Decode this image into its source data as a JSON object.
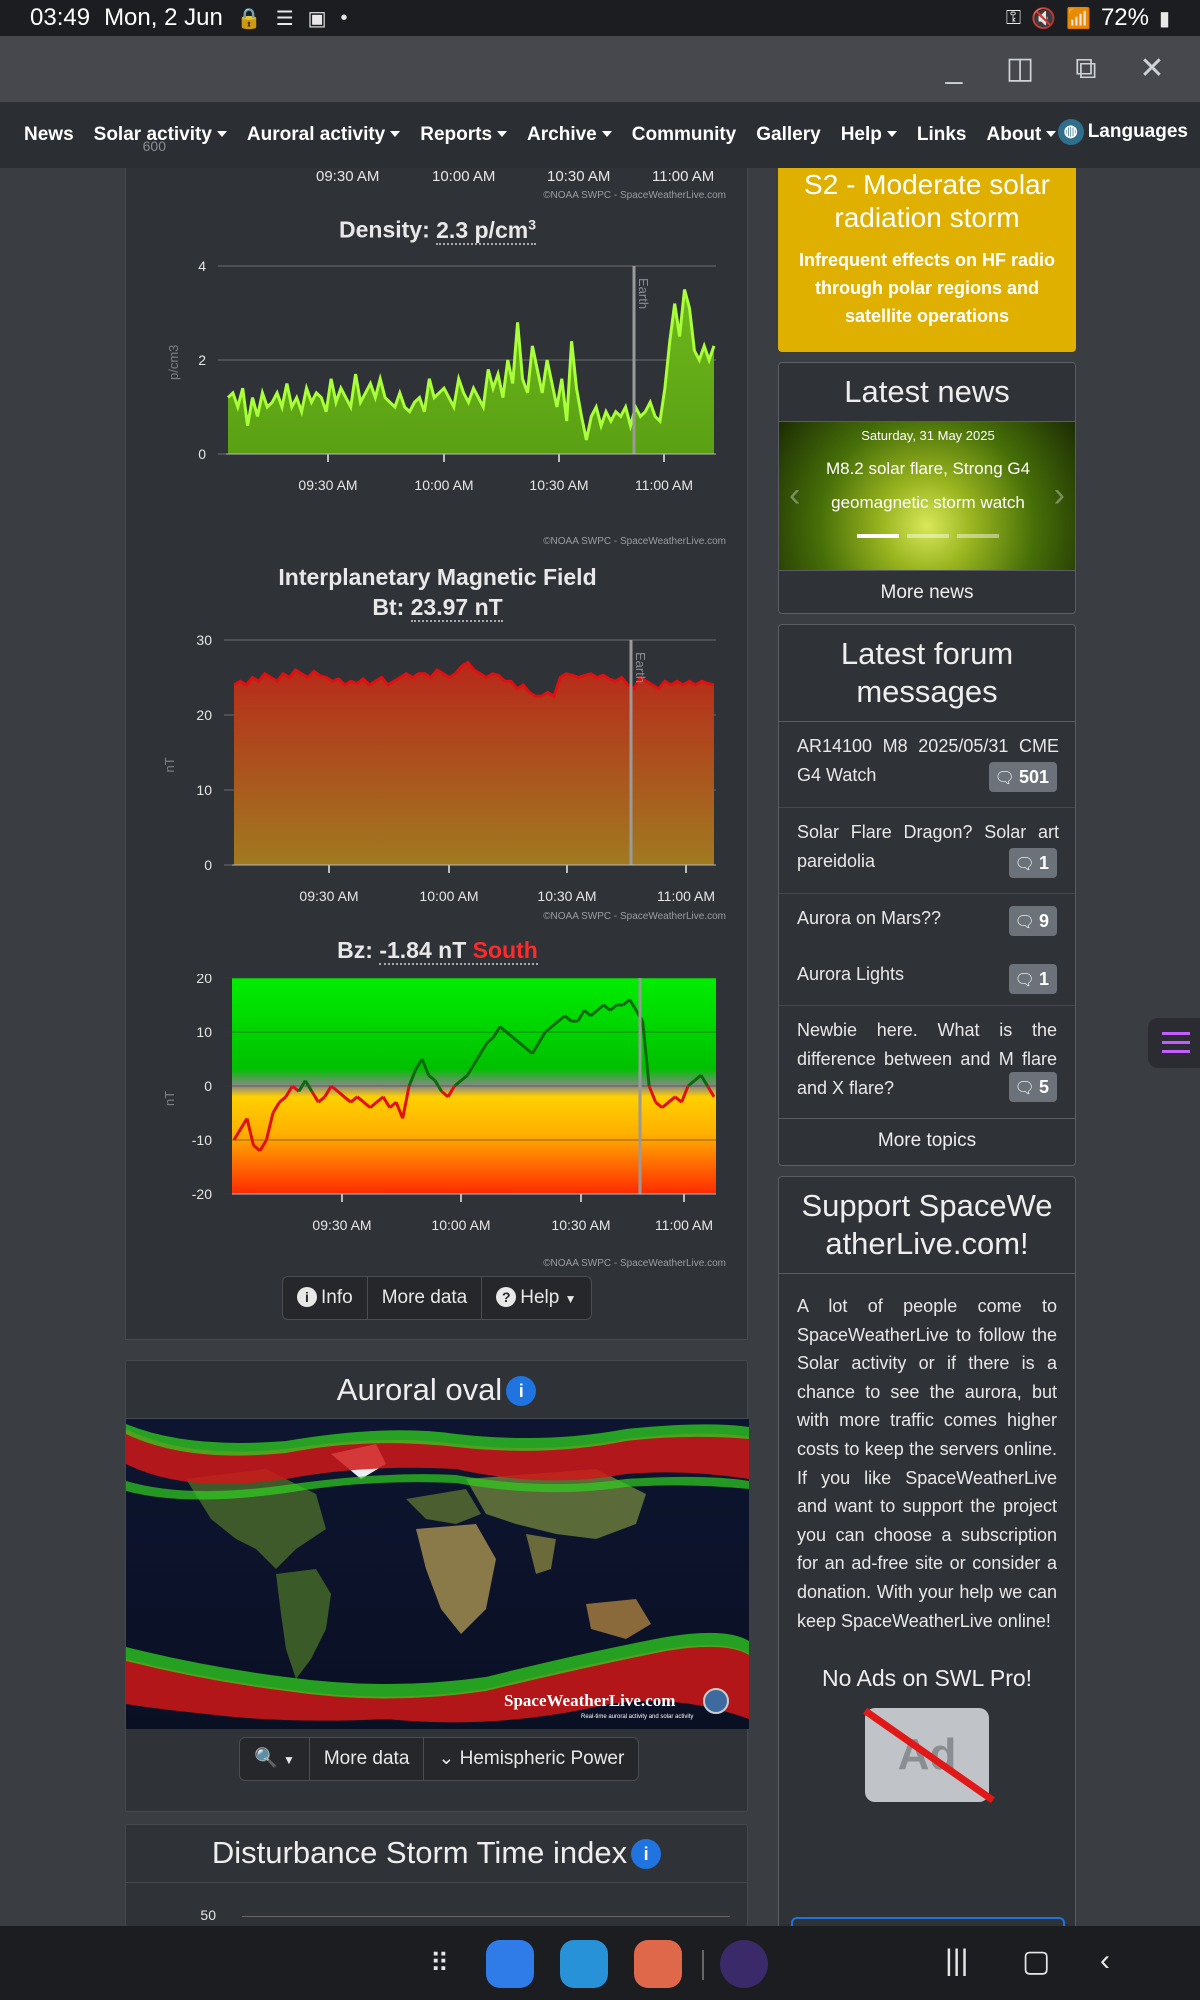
{
  "status_bar": {
    "time": "03:49",
    "date": "Mon, 2 Jun",
    "dot": "•",
    "battery": "72%"
  },
  "window_controls": {
    "minimize": "_",
    "split": "◫",
    "popup": "⧉",
    "close": "✕"
  },
  "nav": {
    "items": [
      {
        "label": "News",
        "dropdown": false
      },
      {
        "label": "Solar activity",
        "dropdown": true
      },
      {
        "label": "Auroral activity",
        "dropdown": true
      },
      {
        "label": "Reports",
        "dropdown": true
      },
      {
        "label": "Archive",
        "dropdown": true
      },
      {
        "label": "Community",
        "dropdown": false
      },
      {
        "label": "Gallery",
        "dropdown": false
      },
      {
        "label": "Help",
        "dropdown": true
      },
      {
        "label": "Links",
        "dropdown": false
      },
      {
        "label": "About",
        "dropdown": true
      }
    ],
    "languages": "Languages"
  },
  "speed_chart_tail": {
    "ytick": "600",
    "xticks": [
      "09:30 AM",
      "10:00 AM",
      "10:30 AM",
      "11:00 AM"
    ],
    "credit": "©NOAA SWPC - SpaceWeatherLive.com"
  },
  "density": {
    "title_prefix": "Density:",
    "value": "2.3 p/cm",
    "sup": "3",
    "ylabel": "p/cm3",
    "marker": "Earth",
    "credit": "©NOAA SWPC - SpaceWeatherLive.com"
  },
  "imf": {
    "title_line1": "Interplanetary Magnetic Field",
    "title_prefix": "Bt:",
    "value": "23.97 nT",
    "ylabel": "nT",
    "marker": "Earth",
    "credit": "©NOAA SWPC - SpaceWeatherLive.com"
  },
  "bz": {
    "title_prefix": "Bz:",
    "value": "-1.84 nT",
    "direction": "South",
    "ylabel": "nT",
    "credit": "©NOAA SWPC - SpaceWeatherLive.com"
  },
  "chart_data": [
    {
      "type": "area",
      "title": "Density: 2.3 p/cm3",
      "ylabel": "p/cm3",
      "x_range": [
        "09:10 AM",
        "11:10 AM"
      ],
      "xticks": [
        "09:30 AM",
        "10:00 AM",
        "10:30 AM",
        "11:00 AM"
      ],
      "yticks": [
        "0",
        "2",
        "4"
      ],
      "ylim": [
        0,
        4
      ],
      "color": "#7ed321",
      "earth_marker": "10:52 AM",
      "values": [
        1.2,
        1.3,
        1.0,
        1.4,
        0.6,
        1.2,
        0.8,
        1.3,
        1.0,
        1.1,
        1.3,
        1.0,
        1.5,
        1.0,
        1.2,
        0.9,
        1.4,
        1.1,
        1.3,
        1.2,
        0.9,
        1.6,
        1.1,
        1.4,
        1.2,
        1.0,
        1.7,
        1.1,
        1.3,
        1.5,
        1.2,
        1.6,
        1.2,
        1.1,
        1.0,
        1.3,
        1.0,
        0.9,
        1.1,
        1.2,
        0.9,
        1.6,
        1.2,
        1.3,
        1.4,
        1.2,
        1.0,
        1.6,
        1.3,
        1.1,
        1.4,
        1.2,
        1.0,
        1.8,
        1.4,
        1.7,
        1.2,
        2.0,
        1.5,
        2.8,
        1.6,
        1.3,
        2.3,
        1.8,
        1.3,
        2.0,
        1.5,
        1.0,
        1.6,
        0.7,
        2.4,
        1.4,
        0.8,
        0.3,
        0.8,
        1.0,
        0.6,
        0.9,
        0.7,
        0.9,
        0.8,
        1.0,
        0.6,
        1.0,
        0.8,
        0.9,
        1.1,
        0.8,
        0.7,
        1.4,
        2.4,
        3.2,
        2.5,
        3.5,
        3.1,
        2.2,
        2.0,
        2.3,
        2.0,
        2.3
      ]
    },
    {
      "type": "area",
      "title": "Interplanetary Magnetic Field Bt: 23.97 nT",
      "ylabel": "nT",
      "x_range": [
        "09:15 AM",
        "11:10 AM"
      ],
      "xticks": [
        "09:30 AM",
        "10:00 AM",
        "10:30 AM",
        "11:00 AM"
      ],
      "yticks": [
        "0",
        "10",
        "20",
        "30"
      ],
      "ylim": [
        0,
        30
      ],
      "color": "#d22a1a",
      "earth_marker": "10:52 AM",
      "values": [
        24,
        24.5,
        24,
        25,
        24.5,
        25.5,
        25,
        24.5,
        25.5,
        25,
        26,
        25.5,
        25,
        25.8,
        25.2,
        25,
        24.5,
        24.8,
        24,
        24.5,
        24.2,
        24.8,
        24,
        24.5,
        25,
        24,
        24.5,
        25,
        25.5,
        25,
        25.5,
        25.5,
        25,
        26,
        25.5,
        25,
        25.5,
        26.5,
        27,
        26,
        25.5,
        25,
        25.5,
        25.3,
        24.5,
        24.5,
        23.5,
        24,
        23,
        22.5,
        22.5,
        23,
        22.5,
        25,
        25.5,
        25.3,
        25,
        25.3,
        25.5,
        25,
        25.3,
        24.8,
        24.5,
        25,
        24,
        23.5,
        25,
        24.5,
        24,
        23.5,
        24.5,
        24,
        24.5,
        24,
        24.5,
        24,
        24.5,
        24.2,
        24
      ]
    },
    {
      "type": "line",
      "title": "Bz: -1.84 nT South",
      "ylabel": "nT",
      "x_range": [
        "09:15 AM",
        "11:10 AM"
      ],
      "xticks": [
        "09:30 AM",
        "10:00 AM",
        "10:30 AM",
        "11:00 AM"
      ],
      "yticks": [
        "20",
        "10",
        "0",
        "-10",
        "-20"
      ],
      "ylim": [
        -20,
        20
      ],
      "earth_marker": "10:52 AM",
      "values": [
        -10,
        -8,
        -6,
        -11,
        -12,
        -10,
        -5,
        -3,
        -2,
        0,
        -1,
        1,
        -1,
        -3,
        -2,
        0,
        -1,
        -2,
        -3,
        -2,
        -3,
        -4,
        -3,
        -2,
        -4,
        -3,
        -6,
        0,
        3,
        5,
        2,
        1,
        -1,
        -2,
        0,
        1,
        2,
        4,
        6,
        8,
        9,
        11,
        10,
        9,
        8,
        7,
        6,
        8,
        10,
        11,
        12,
        13,
        12,
        12,
        14,
        13,
        14,
        15,
        14,
        15,
        15,
        16,
        14,
        12,
        0,
        -3,
        -4,
        -3,
        -2,
        -3,
        0,
        1,
        2,
        0,
        -2
      ]
    }
  ],
  "chart_buttons": {
    "info": "Info",
    "more_data": "More data",
    "help": "Help"
  },
  "auroral_oval": {
    "title": "Auroral oval",
    "watermark": "SpaceWeatherLive.com",
    "watermark_sub": "Real-time auroral activity and solar activity",
    "more_data": "More data",
    "hemispheric_power": "Hemispheric Power"
  },
  "dst": {
    "title": "Disturbance Storm Time index",
    "ytick": "50"
  },
  "alert": {
    "title": "S2 - Moderate solar radiation storm",
    "desc": "Infrequent effects on HF radio through polar regions and satellite operations"
  },
  "latest_news": {
    "title": "Latest news",
    "date": "Saturday, 31 May 2025",
    "headline": "M8.2 solar flare, Strong G4 geomagnetic storm watch",
    "more": "More news"
  },
  "forum": {
    "title": "Latest forum messages",
    "items": [
      {
        "text": "AR14100 M8 2025/05/31 CME G4 Watch",
        "count": "501"
      },
      {
        "text": "Solar Flare Dragon? Solar art pareidolia",
        "count": "1"
      },
      {
        "text": "Aurora on Mars??",
        "count": "9"
      },
      {
        "text": "Aurora Lights",
        "count": "1"
      },
      {
        "text": "Newbie here. What is the difference between and M flare and X flare?",
        "count": "5"
      }
    ],
    "more": "More topics"
  },
  "support": {
    "title": "Support SpaceWeatherLive.com!",
    "text": "A lot of people come to SpaceWeatherLive to follow the Solar activity or if there is a chance to see the aurora, but with more traffic comes higher costs to keep the servers online. If you like SpaceWeatherLive and want to support the project you can choose a subscription for an ad-free site or consider a donation. With your help we can keep SpaceWeatherLive online!",
    "no_ads": "No Ads on SWL Pro!",
    "ad_label": "Ad"
  },
  "colors": {
    "density": "#7ed321",
    "imf": "#d22a1a",
    "alert": "#e0b000",
    "info": "#1f74e0"
  }
}
